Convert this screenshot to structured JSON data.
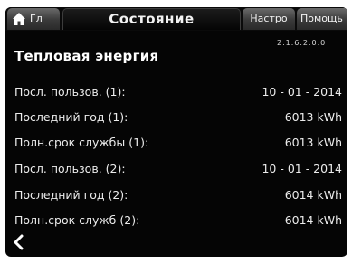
{
  "tabs": {
    "home_label": "Гл",
    "active_label": "Состояние",
    "settings_label": "Настро",
    "help_label": "Помощь"
  },
  "version": "2.1.6.2.0.0",
  "section_title": "Тепловая энергия",
  "rows": [
    {
      "label": "Посл. пользов. (1):",
      "value": "10 - 01 - 2014"
    },
    {
      "label": "Последний год (1):",
      "value": "6013 kWh"
    },
    {
      "label": "Полн.срок службы (1):",
      "value": "6013 kWh"
    },
    {
      "label": "Посл. пользов. (2):",
      "value": "10 - 01 - 2014"
    },
    {
      "label": "Последний год (2):",
      "value": "6014 kWh"
    },
    {
      "label": "Полн.срок служб (2):",
      "value": "6014 kWh"
    }
  ],
  "icons": {
    "home": "home-icon",
    "back": "chevron-left-icon"
  }
}
